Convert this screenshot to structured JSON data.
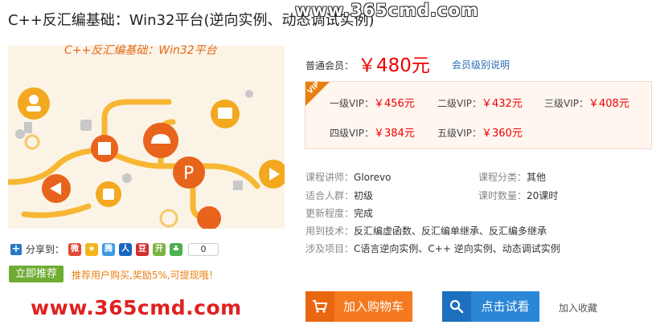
{
  "course": {
    "title": "C++反汇编基础：Win32平台(逆向实例、动态调试实例)",
    "cover_caption": "C++反汇编基础：Win32平台"
  },
  "watermark_top": "www.365cmd.com",
  "share": {
    "label": "分享到：",
    "count": "0",
    "icons": [
      "weibo-icon",
      "qzone-icon",
      "qq-weibo-icon",
      "renren-icon",
      "douban-icon",
      "kaixin-icon",
      "pengyou-icon"
    ]
  },
  "recommend": {
    "button": "立即推荐",
    "promo": "推荐用户购买,奖励5%,可提现哦！"
  },
  "site_watermark": "www.365cmd.com",
  "price": {
    "label": "普通会员：",
    "value": "￥480元",
    "member_link": "会员级别说明"
  },
  "vip": {
    "badge": "VIP",
    "levels": [
      {
        "label": "一级VIP：",
        "price": "￥456元"
      },
      {
        "label": "二级VIP：",
        "price": "￥432元"
      },
      {
        "label": "三级VIP：",
        "price": "￥408元"
      },
      {
        "label": "四级VIP：",
        "price": "￥384元"
      },
      {
        "label": "五级VIP：",
        "price": "￥360元"
      }
    ]
  },
  "info": {
    "lecturer_label": "课程讲师：",
    "lecturer": "Glorevo",
    "category_label": "课程分类：",
    "category": "其他",
    "audience_label": "适合人群：",
    "audience": "初级",
    "lessons_label": "课时数量：",
    "lessons": "20课时",
    "progress_label": "更新程度：",
    "progress": "完成",
    "tech_label": "用到技术：",
    "tech": "反汇编虚函数、反汇编单继承、反汇编多继承",
    "project_label": "涉及项目：",
    "project": "C语言逆向实例、C++ 逆向实例、动态调试实例"
  },
  "actions": {
    "add_cart": "加入购物车",
    "trial": "点击试看",
    "favorite": "加入收藏"
  },
  "colors": {
    "price_red": "#ee0000",
    "orange": "#f4791f",
    "blue": "#2b86d6",
    "green": "#6fac34"
  }
}
